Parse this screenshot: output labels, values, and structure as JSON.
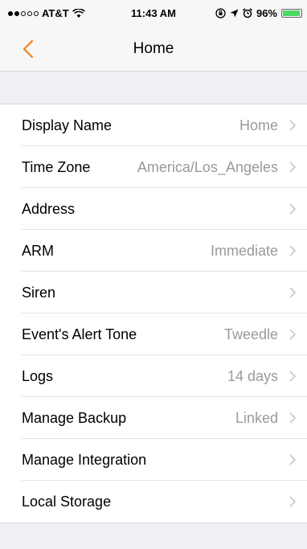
{
  "status_bar": {
    "carrier": "AT&T",
    "time": "11:43 AM",
    "battery": "96%",
    "battery_level": 0.96,
    "signal_dots_filled": 2,
    "signal_dots_total": 5
  },
  "nav": {
    "title": "Home",
    "back_icon": "chevron-left-icon"
  },
  "colors": {
    "accent": "#f5821f",
    "value_text": "#9a9a9a",
    "background": "#efeff4"
  },
  "settings": {
    "rows": [
      {
        "label": "Display Name",
        "value": "Home"
      },
      {
        "label": "Time Zone",
        "value": "America/Los_Angeles"
      },
      {
        "label": "Address",
        "value": ""
      },
      {
        "label": "ARM",
        "value": "Immediate"
      },
      {
        "label": "Siren",
        "value": ""
      },
      {
        "label": "Event's Alert Tone",
        "value": "Tweedle"
      },
      {
        "label": "Logs",
        "value": "14 days"
      },
      {
        "label": "Manage Backup",
        "value": "Linked"
      },
      {
        "label": "Manage Integration",
        "value": ""
      },
      {
        "label": "Local Storage",
        "value": ""
      }
    ]
  }
}
